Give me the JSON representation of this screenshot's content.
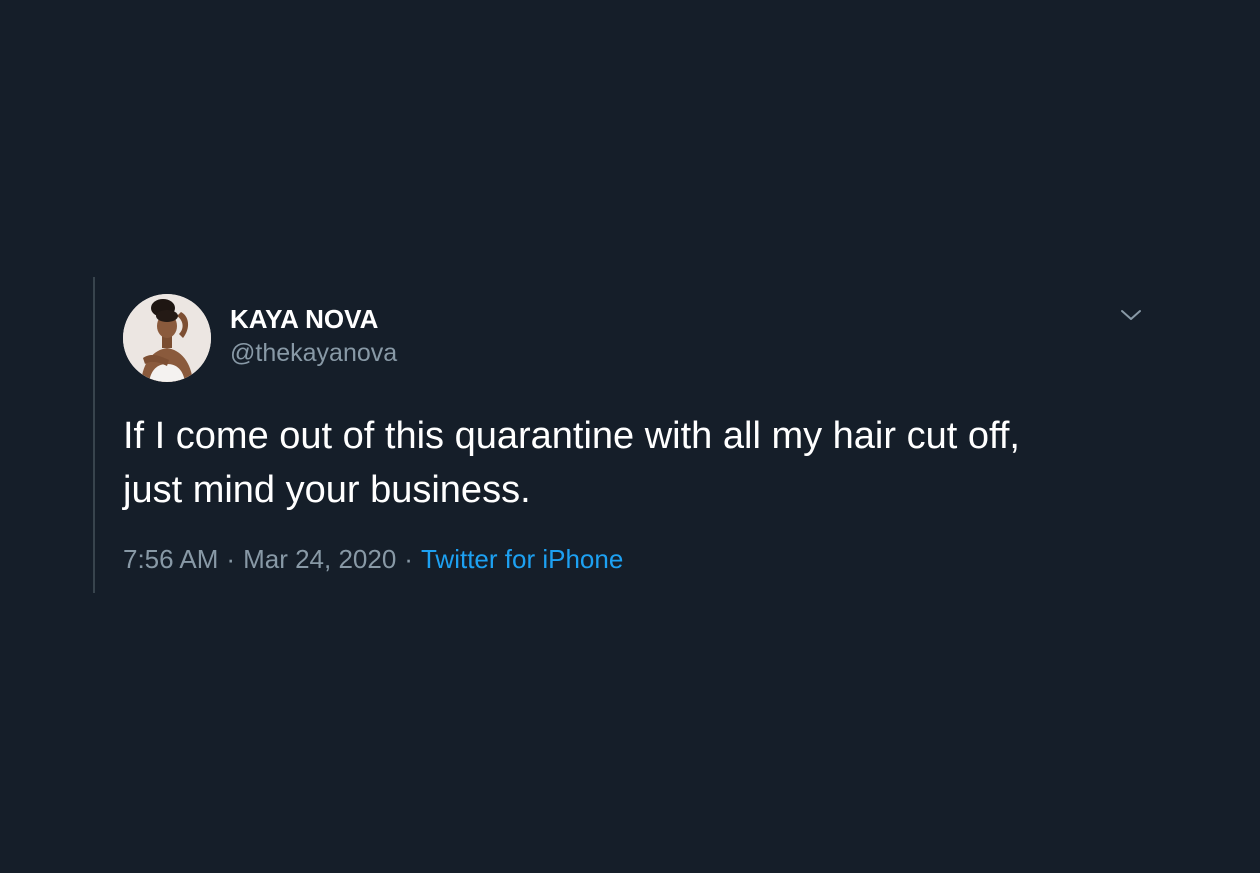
{
  "tweet": {
    "author": {
      "display_name": "KAYA NOVA",
      "handle": "@thekayanova",
      "avatar_icon": "profile-photo"
    },
    "text_line_1": "If I come out of this quarantine with all my hair cut off,",
    "text_line_2": "just mind your business.",
    "time": "7:56 AM",
    "date": "Mar 24, 2020",
    "separator": "·",
    "source": "Twitter for iPhone",
    "menu_icon": "chevron-down-icon"
  },
  "colors": {
    "background": "#151e29",
    "text_primary": "#ffffff",
    "text_secondary": "#8899a6",
    "link": "#1da1f2",
    "thread_line": "#38444d"
  }
}
